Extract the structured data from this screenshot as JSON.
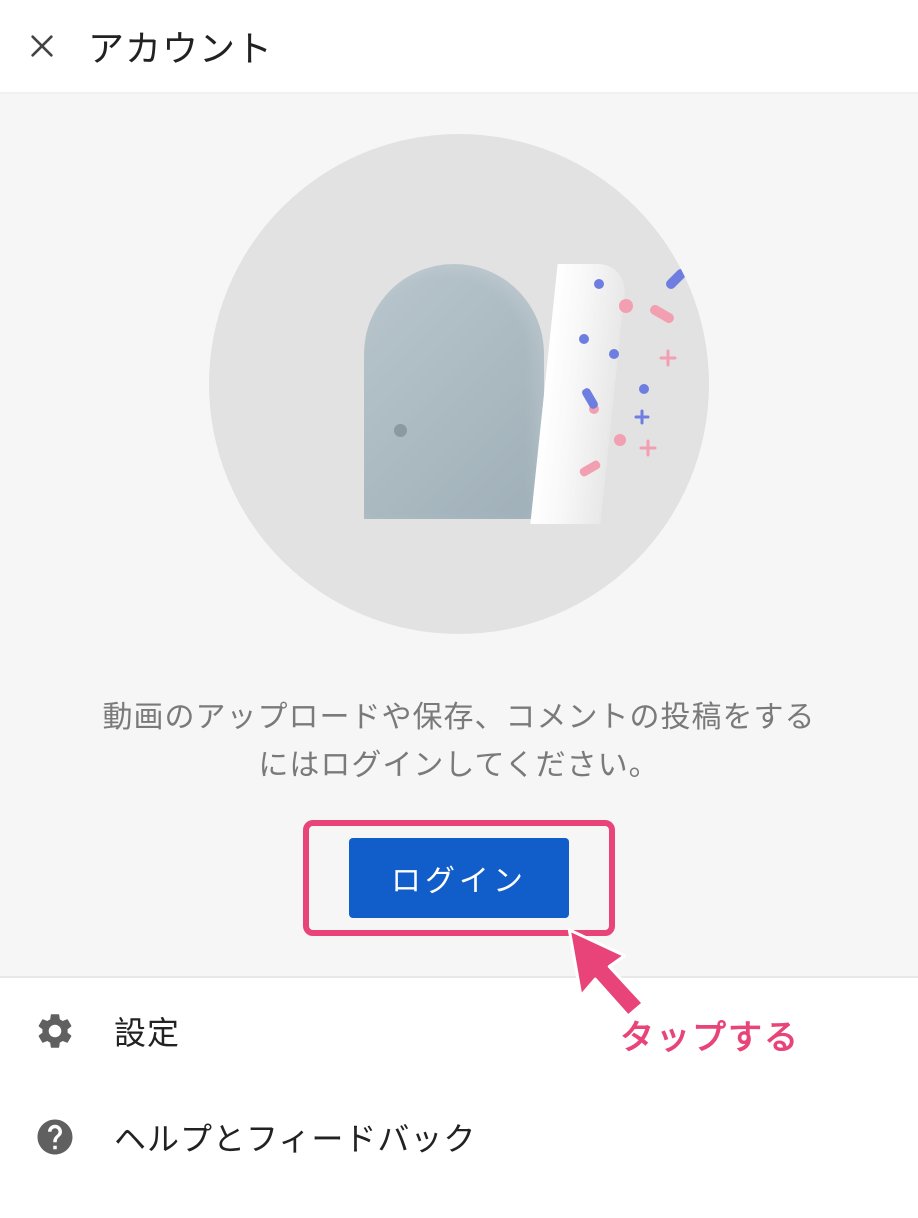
{
  "header": {
    "title": "アカウント"
  },
  "prompt": {
    "text": "動画のアップロードや保存、コメントの投稿をするにはログインしてください。"
  },
  "login_button": {
    "label": "ログイン"
  },
  "annotation": {
    "label": "タップする"
  },
  "menu": {
    "settings": {
      "label": "設定"
    },
    "help": {
      "label": "ヘルプとフィードバック"
    }
  },
  "colors": {
    "accent": "#115dc9",
    "annotation": "#e8447a",
    "confetti_blue": "#6d7de0",
    "confetti_pink": "#f29fb2"
  }
}
